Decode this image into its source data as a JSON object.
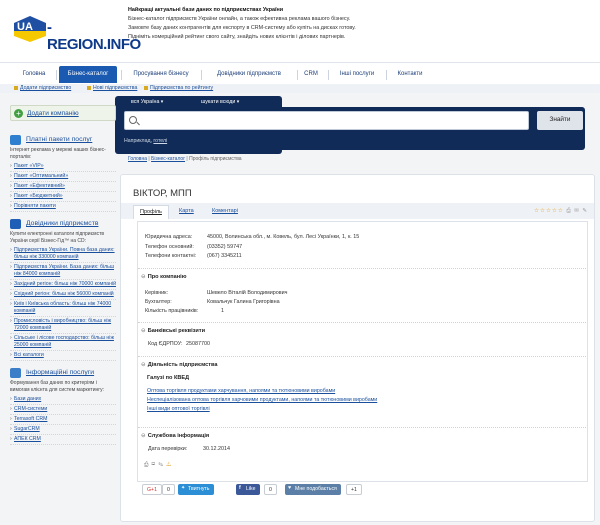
{
  "header": {
    "logo_prefix": "UA",
    "logo_name": "-REGION.INFO",
    "tagline_title": "Найкращі актуальні бази даних по підприємствах України",
    "tagline_lines": [
      "Бізнес-каталог підприємств України онлайн, а також ефективна реклама вашого бізнесу.",
      "Замовте базу даних контрагентів для експорту в CRM-систему або купіть на дисках готову.",
      "Підніміть комерційний рейтинг свого сайту, знайдіть нових клієнтів і ділових партнерів."
    ]
  },
  "nav": {
    "items": [
      "Головна",
      "Бізнес-каталог",
      "Просування бізнесу",
      "Довідники підприємств",
      "CRM",
      "Інші послуги",
      "Контакти"
    ],
    "active": "Бізнес-каталог"
  },
  "subnav": [
    "Додати підприємство",
    "Нові підприємства",
    "Підприємства по рейтингу"
  ],
  "search": {
    "region": "вся Україна",
    "scope": "шукати всюди",
    "button": "Знайти",
    "example_label": "Наприклад,",
    "example_link": "готелі"
  },
  "sidebar": {
    "add_company": "Додати компанію",
    "paid": {
      "title": "Платні пакети послуг",
      "desc": "Інтернет реклама у мережі наших бізнес-порталів:",
      "links": [
        "Пакет «VIP»",
        "Пакет «Оптимальний»",
        "Пакет «Ефективний»",
        "Пакет «Бюджетний»",
        "Порівняти пакети"
      ]
    },
    "dirs": {
      "title": "Довідники підприємств",
      "desc": "Купити електронні каталоги підприємств України серії Бізнес-Гід™ на CD:",
      "links": [
        "Підприємства України. Повна база даних: більш ніж 330000 компаній",
        "Підприємства України. База даних: більш ніж 84000 компаній",
        "Західний регіон: більш ніж 70000 компаній",
        "Східний регіон: більш ніж 56000 компаній",
        "Київ і Київська область: більш ніж 74000 компаній",
        "Промисловість і виробництво: більш ніж 72000 компаній",
        "Сільське і лісове господарство: більш ніж 25000 компаній",
        "Всі каталоги"
      ]
    },
    "info": {
      "title": "Інформаційні послуги",
      "desc": "Формування баз даних по критеріям і вимогам клієнта для систем маркетингу:",
      "links": [
        "Бази даних",
        "CRM-системи",
        "Terrasoft CRM",
        "SugarCRM",
        "АПЕК CRM"
      ]
    }
  },
  "breadcrumb": [
    "Головна",
    "Бізнес-каталог",
    "Профіль підприємства"
  ],
  "company": {
    "title": "ВІКТОР, МПП",
    "tabs": [
      "Профіль",
      "Карта",
      "Коментарі"
    ],
    "rating_stars": 5,
    "legal_address_label": "Юридична адреса:",
    "legal_address": "45000, Волинська обл., м. Ковель, бул. Лесі Українки, 1, к. 15",
    "phone_main_label": "Телефон основний:",
    "phone_main": "(03352) 59747",
    "phone_contact_label": "Телефони контактні:",
    "phone_contact": "(067) 3345211",
    "about_title": "Про компанію",
    "director_label": "Керівник:",
    "director": "Шевело Віталій Володимирович",
    "accountant_label": "Бухгалтер:",
    "accountant": "Ковальчук Галина Григорівна",
    "staff_label": "Кількість працівників:",
    "staff": "1",
    "bank_title": "Банківські реквізити",
    "edrpou_label": "Код ЄДРПОУ:",
    "edrpou": "25087700",
    "activity_title": "Діяльність підприємства",
    "kved_title": "Галузі по КВЕД",
    "kved": [
      "Оптова торгівля продуктами харчування, напоями та тютюновими виробами",
      "Неспеціалізована оптова торгівля харчовими продуктами, напоями та тютюновими виробами",
      "Інші види оптової торгівлі"
    ],
    "service_title": "Службова інформація",
    "check_label": "Дата перевірки:",
    "check_date": "30.12.2014"
  },
  "social": {
    "gplus": "G+1",
    "gplus_count": "0",
    "tweet": "Твитнуть",
    "fb_like": "Like",
    "fb_count": "0",
    "vk": "Мне подобається",
    "vk_count": "+1"
  }
}
